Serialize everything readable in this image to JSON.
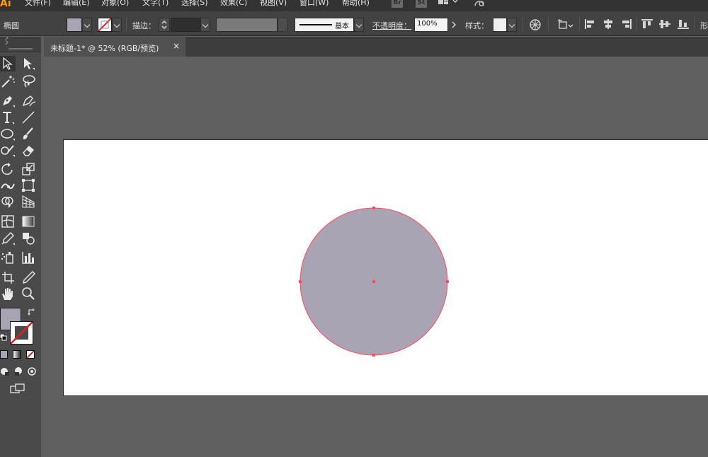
{
  "app": {
    "logo": "Ai"
  },
  "menu": {
    "items": [
      {
        "label": "文件(F)"
      },
      {
        "label": "编辑(E)"
      },
      {
        "label": "对象(O)"
      },
      {
        "label": "文字(T)"
      },
      {
        "label": "选择(S)"
      },
      {
        "label": "效果(C)"
      },
      {
        "label": "视图(V)"
      },
      {
        "label": "窗口(W)"
      },
      {
        "label": "帮助(H)"
      }
    ],
    "bridge_badge": "Br",
    "stock_badge": "St"
  },
  "controlbar": {
    "object_type": "椭圆",
    "fill_color": "#aaa3b4",
    "stroke_label": "描边：",
    "stroke_profile_label": "基本",
    "opacity_label": "不透明度：",
    "opacity_value": "100%",
    "style_label": "样式：",
    "transform_label": "形"
  },
  "document": {
    "tab_title": "未标题-1* @ 52% (RGB/预览)",
    "close_glyph": "×"
  },
  "colors": {
    "shape_fill": "#aaa3b4",
    "selection": "#ff4a5a",
    "artboard": "#ffffff",
    "pasteboard": "#5f5f5f",
    "accent": "#ff9a00"
  },
  "tools": {
    "fill_color": "#aaa3b4"
  }
}
